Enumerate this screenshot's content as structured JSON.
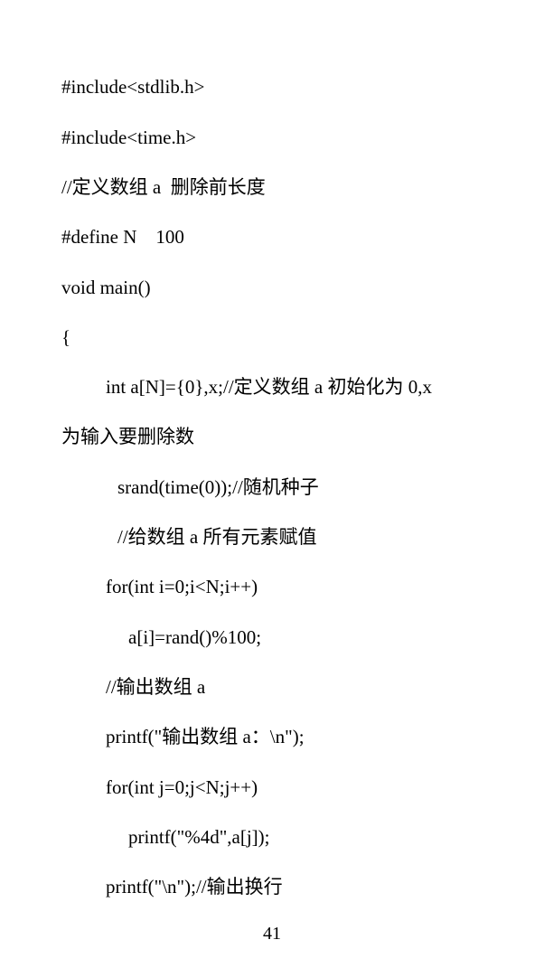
{
  "document": {
    "lines": [
      "#include<stdlib.h>",
      "#include<time.h>",
      "//定义数组 a  删除前长度",
      "#define N    100",
      "void main()",
      "{",
      "int a[N]={0},x;//定义数组 a 初始化为 0,x",
      "为输入要删除数",
      "srand(time(0));//随机种子",
      "//给数组 a 所有元素赋值",
      "for(int i=0;i<N;i++)",
      "a[i]=rand()%100;",
      "//输出数组 a",
      "printf(\"输出数组 a：\\n\");",
      "for(int j=0;j<N;j++)",
      "printf(\"%4d\",a[j]);",
      "printf(\"\\n\");//输出换行"
    ],
    "page_number": "41"
  }
}
